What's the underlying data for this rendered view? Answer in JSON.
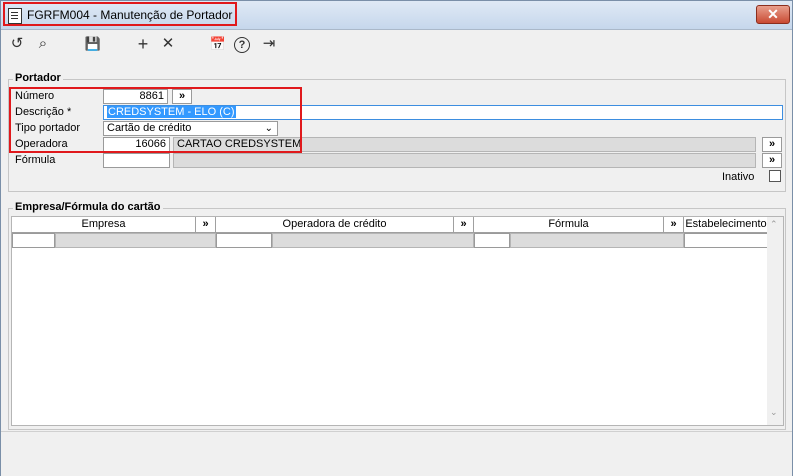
{
  "window": {
    "title": "FGRFM004 - Manutenção de Portador",
    "close_glyph": "✕"
  },
  "toolbar": {
    "undo": "↺",
    "search": "⌕",
    "save": "💾",
    "add": "+",
    "delete": "✕",
    "calendar": "📅",
    "help": "?",
    "exit": "⇥"
  },
  "portador": {
    "group_label": "Portador",
    "numero_label": "Número",
    "numero_value": "8861",
    "descricao_label": "Descrição *",
    "descricao_value": "CREDSYSTEM - ELO (C)",
    "tipo_label": "Tipo portador",
    "tipo_value": "Cartão de crédito",
    "operadora_label": "Operadora",
    "operadora_code": "16066",
    "operadora_name": "CARTAO CREDSYSTEM",
    "formula_label": "Fórmula",
    "formula_value": "",
    "inativo_label": "Inativo",
    "more_glyph": "»"
  },
  "empresa_grid": {
    "group_label": "Empresa/Fórmula do cartão",
    "columns": [
      "Empresa",
      "Operadora de crédito",
      "Fórmula",
      "Estabelecimento"
    ],
    "more_glyph": "»"
  }
}
